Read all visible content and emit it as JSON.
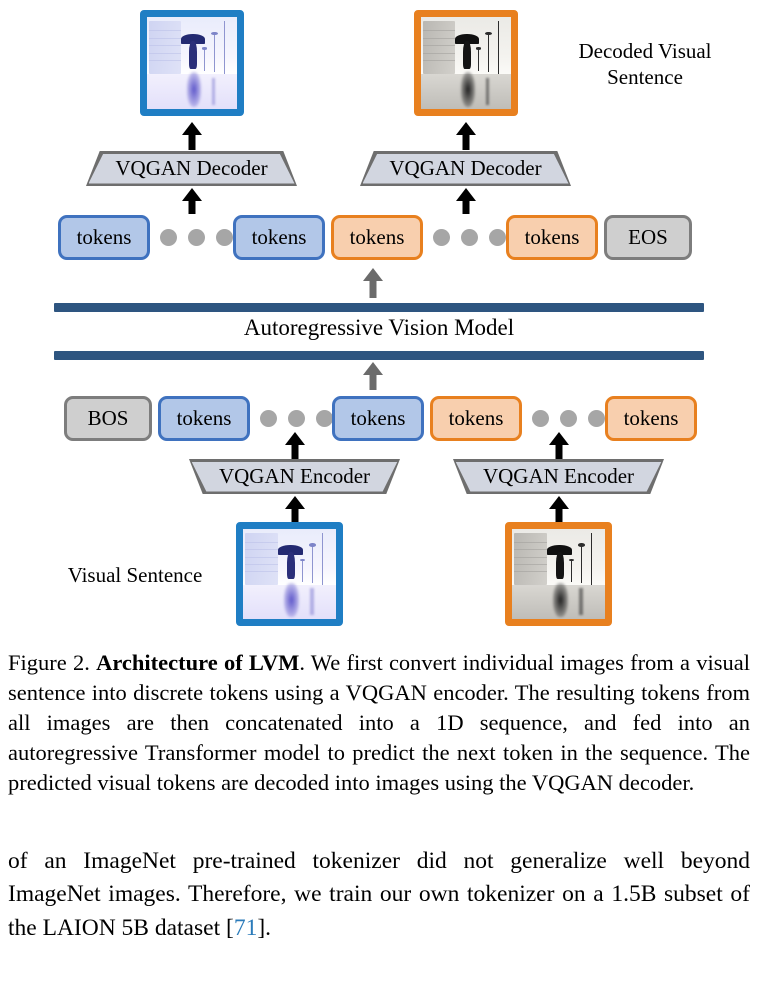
{
  "figure": {
    "decoder_left_label": "VQGAN Decoder",
    "decoder_right_label": "VQGAN Decoder",
    "encoder_left_label": "VQGAN Encoder",
    "encoder_right_label": "VQGAN Encoder",
    "model_label": "Autoregressive Vision Model",
    "decoded_label_line1": "Decoded Visual",
    "decoded_label_line2": "Sentence",
    "visual_sentence_label": "Visual Sentence",
    "top_row": [
      {
        "text": "tokens",
        "style": "tok-blue"
      },
      {
        "text": "tokens",
        "style": "tok-blue"
      },
      {
        "text": "tokens",
        "style": "tok-orange"
      },
      {
        "text": "tokens",
        "style": "tok-orange"
      },
      {
        "text": "EOS",
        "style": "tok-gray"
      }
    ],
    "bottom_row": [
      {
        "text": "BOS",
        "style": "tok-gray"
      },
      {
        "text": "tokens",
        "style": "tok-blue"
      },
      {
        "text": "tokens",
        "style": "tok-blue"
      },
      {
        "text": "tokens",
        "style": "tok-orange"
      },
      {
        "text": "tokens",
        "style": "tok-orange"
      }
    ],
    "colors": {
      "token_blue_fill": "#b2c7e8",
      "token_blue_border": "#3f72bf",
      "token_orange_fill": "#f8cfae",
      "token_orange_border": "#e8801f",
      "token_gray_fill": "#cfcfcf",
      "token_gray_border": "#7d7d7d",
      "model_bar": "#2e5580",
      "trapezoid_fill": "#d2d6e0",
      "trapezoid_border": "#6e6e6e",
      "dot": "#a6a6a6",
      "gray_arrow": "#6b6b6b",
      "image_border_blue": "#1f7ec4",
      "image_border_orange": "#e8801f"
    },
    "images": {
      "top_left_alt": "blue-tinted photo of person with umbrella on rainy street",
      "top_right_alt": "grayscale photo of person with umbrella on rainy street",
      "bottom_left_alt": "blue-tinted photo of person with umbrella on rainy street",
      "bottom_right_alt": "grayscale photo of person with umbrella on rainy street"
    }
  },
  "caption": {
    "prefix": "Figure 2. ",
    "bold": "Architecture of LVM",
    "rest": ". We first convert individual images from a visual sentence into discrete tokens using a VQGAN encoder. The resulting tokens from all images are then concatenated into a 1D sequence, and fed into an autoregressive Transformer model to predict the next token in the sequence. The predicted visual tokens are decoded into images using the VQGAN decoder."
  },
  "body": {
    "part1": "of an ImageNet pre-trained tokenizer did not generalize well beyond ImageNet images. Therefore, we train our own tokenizer on a 1.5B subset of the LAION 5B dataset [",
    "citation": "71",
    "part2": "]."
  }
}
